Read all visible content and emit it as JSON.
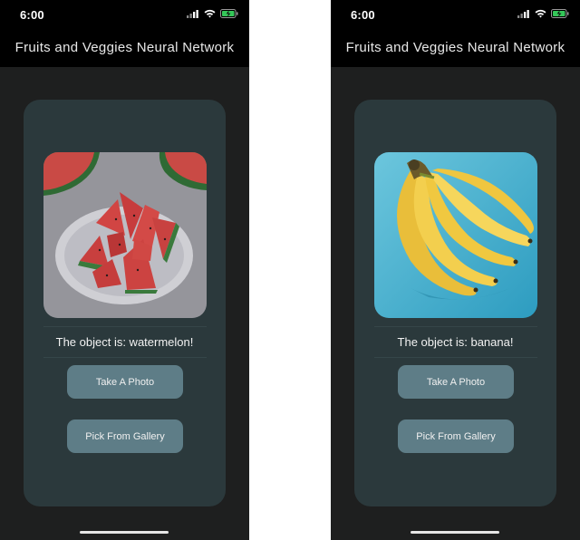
{
  "screens": [
    {
      "status": {
        "time": "6:00",
        "icons": [
          "cellular-signal-icon",
          "wifi-icon",
          "battery-charging-icon"
        ]
      },
      "appbar": {
        "title": "Fruits and Veggies Neural Network"
      },
      "card": {
        "photo_icon": "watermelon-photo",
        "result_text": "The object is: watermelon!",
        "take_photo_label": "Take A Photo",
        "pick_gallery_label": "Pick From Gallery"
      }
    },
    {
      "status": {
        "time": "6:00",
        "icons": [
          "cellular-signal-icon",
          "wifi-icon",
          "battery-charging-icon"
        ]
      },
      "appbar": {
        "title": "Fruits and Veggies Neural Network"
      },
      "card": {
        "photo_icon": "banana-photo",
        "result_text": "The object is: banana!",
        "take_photo_label": "Take A Photo",
        "pick_gallery_label": "Pick From Gallery"
      }
    }
  ],
  "colors": {
    "background": "#1e1f1f",
    "card": "#2b393c",
    "button": "#5e7d87",
    "appbar": "#000000"
  }
}
